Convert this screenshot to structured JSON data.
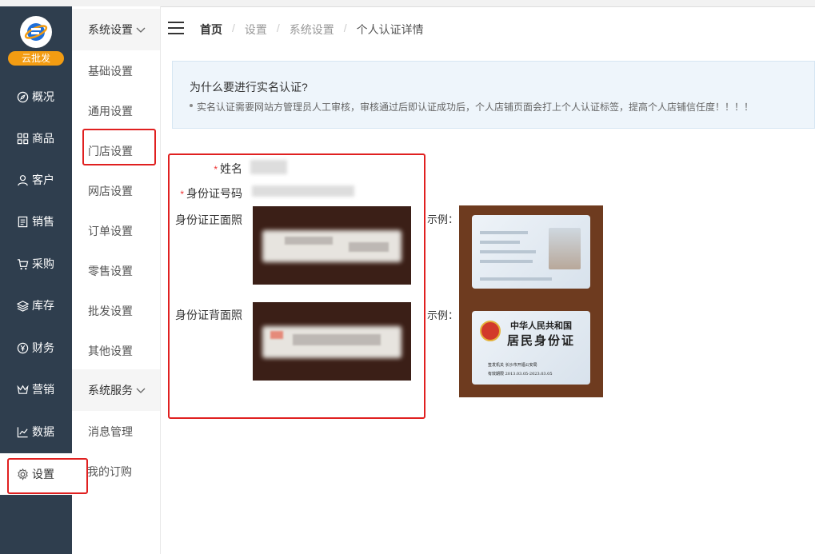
{
  "app": {
    "logo_text": "云批发"
  },
  "sidebar": {
    "items": [
      {
        "label": "概况",
        "icon": "compass-icon"
      },
      {
        "label": "商品",
        "icon": "grid-icon"
      },
      {
        "label": "客户",
        "icon": "user-icon"
      },
      {
        "label": "销售",
        "icon": "document-icon"
      },
      {
        "label": "采购",
        "icon": "cart-icon"
      },
      {
        "label": "库存",
        "icon": "layers-icon"
      },
      {
        "label": "财务",
        "icon": "yen-icon"
      },
      {
        "label": "营销",
        "icon": "crown-icon"
      },
      {
        "label": "数据",
        "icon": "chart-icon"
      },
      {
        "label": "设置",
        "icon": "gear-icon"
      }
    ]
  },
  "submenu": {
    "group1": "系统设置",
    "group1_items": [
      "基础设置",
      "通用设置",
      "门店设置",
      "网店设置",
      "订单设置",
      "零售设置",
      "批发设置",
      "其他设置"
    ],
    "group2": "系统服务",
    "group2_items": [
      "消息管理",
      "我的订购"
    ]
  },
  "breadcrumb": [
    "首页",
    "设置",
    "系统设置",
    "个人认证详情"
  ],
  "notice": {
    "question": "为什么要进行实名认证?",
    "detail": "实名认证需要网站方管理员人工审核，审核通过后即认证成功后，个人店铺页面会打上个人认证标签，提高个人店铺信任度！！！！"
  },
  "form": {
    "name_label": "姓名",
    "id_label": "身份证号码",
    "front_label": "身份证正面照",
    "back_label": "身份证背面照",
    "example_label": "示例："
  },
  "example_card": {
    "back_title": "中华人民共和国",
    "back_subtitle": "居民身份证",
    "authority": "签发机关  长沙市开福公安局",
    "validity": "有效期限  2013.03.05-2023.03.05"
  },
  "colors": {
    "sidebar": "#2f3e4e",
    "accent": "#f39c12",
    "highlight": "#e02020"
  }
}
